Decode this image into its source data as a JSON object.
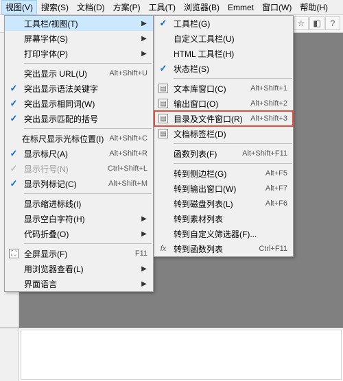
{
  "menubar": {
    "items": [
      {
        "label": "视图(V)",
        "active": true
      },
      {
        "label": "搜索(S)"
      },
      {
        "label": "文档(D)"
      },
      {
        "label": "方案(P)"
      },
      {
        "label": "工具(T)"
      },
      {
        "label": "浏览器(B)"
      },
      {
        "label": "Emmet"
      },
      {
        "label": "窗口(W)"
      },
      {
        "label": "帮助(H)"
      }
    ]
  },
  "dropdown1": {
    "groups": [
      [
        {
          "label": "工具栏/视图(T)",
          "arrow": true,
          "hover": true
        },
        {
          "label": "屏幕字体(S)",
          "arrow": true
        },
        {
          "label": "打印字体(P)",
          "arrow": true
        }
      ],
      [
        {
          "label": "突出显示 URL(U)",
          "shortcut": "Alt+Shift+U"
        },
        {
          "label": "突出显示语法关键字",
          "check": true
        },
        {
          "label": "突出显示相同词(W)",
          "check": true
        },
        {
          "label": "突出显示匹配的括号",
          "check": true
        }
      ],
      [
        {
          "label": "在标尺显示光标位置(I)",
          "shortcut": "Alt+Shift+C"
        },
        {
          "label": "显示标尺(A)",
          "shortcut": "Alt+Shift+R",
          "check": true
        },
        {
          "label": "显示行号(N)",
          "shortcut": "Ctrl+Shift+L",
          "disabled": true,
          "checkGray": true
        },
        {
          "label": "显示列标记(C)",
          "shortcut": "Alt+Shift+M",
          "check": true
        }
      ],
      [
        {
          "label": "显示缩进标线(I)"
        },
        {
          "label": "显示空白字符(H)",
          "arrow": true
        },
        {
          "label": "代码折叠(O)",
          "arrow": true
        }
      ],
      [
        {
          "label": "全屏显示(F)",
          "shortcut": "F11",
          "icon": "fullscreen"
        },
        {
          "label": "用浏览器查看(L)",
          "arrow": true
        },
        {
          "label": "界面语言",
          "arrow": true
        }
      ]
    ]
  },
  "dropdown2": {
    "groups": [
      [
        {
          "label": "工具栏(G)",
          "check": true
        },
        {
          "label": "自定义工具栏(U)"
        },
        {
          "label": "HTML 工具栏(H)"
        },
        {
          "label": "状态栏(S)",
          "check": true
        }
      ],
      [
        {
          "label": "文本库窗口(C)",
          "shortcut": "Alt+Shift+1",
          "icon": "panel"
        },
        {
          "label": "输出窗口(O)",
          "shortcut": "Alt+Shift+2",
          "icon": "panel"
        },
        {
          "label": "目录及文件窗口(R)",
          "shortcut": "Alt+Shift+3",
          "icon": "panel",
          "highlighted": true
        },
        {
          "label": "文档标签栏(D)",
          "icon": "panel"
        }
      ],
      [
        {
          "label": "函数列表(F)",
          "shortcut": "Alt+Shift+F11"
        }
      ],
      [
        {
          "label": "转到侧边栏(G)",
          "shortcut": "Alt+F5"
        },
        {
          "label": "转到输出窗口(W)",
          "shortcut": "Alt+F7"
        },
        {
          "label": "转到磁盘列表(L)",
          "shortcut": "Alt+F6"
        },
        {
          "label": "转到素材列表"
        },
        {
          "label": "转到自定义筛选器(F)..."
        },
        {
          "label": "转到函数列表",
          "shortcut": "Ctrl+F11",
          "icon": "fx"
        }
      ]
    ]
  },
  "toolbar_right": {
    "icons": [
      "favorite",
      "theme",
      "help"
    ]
  }
}
